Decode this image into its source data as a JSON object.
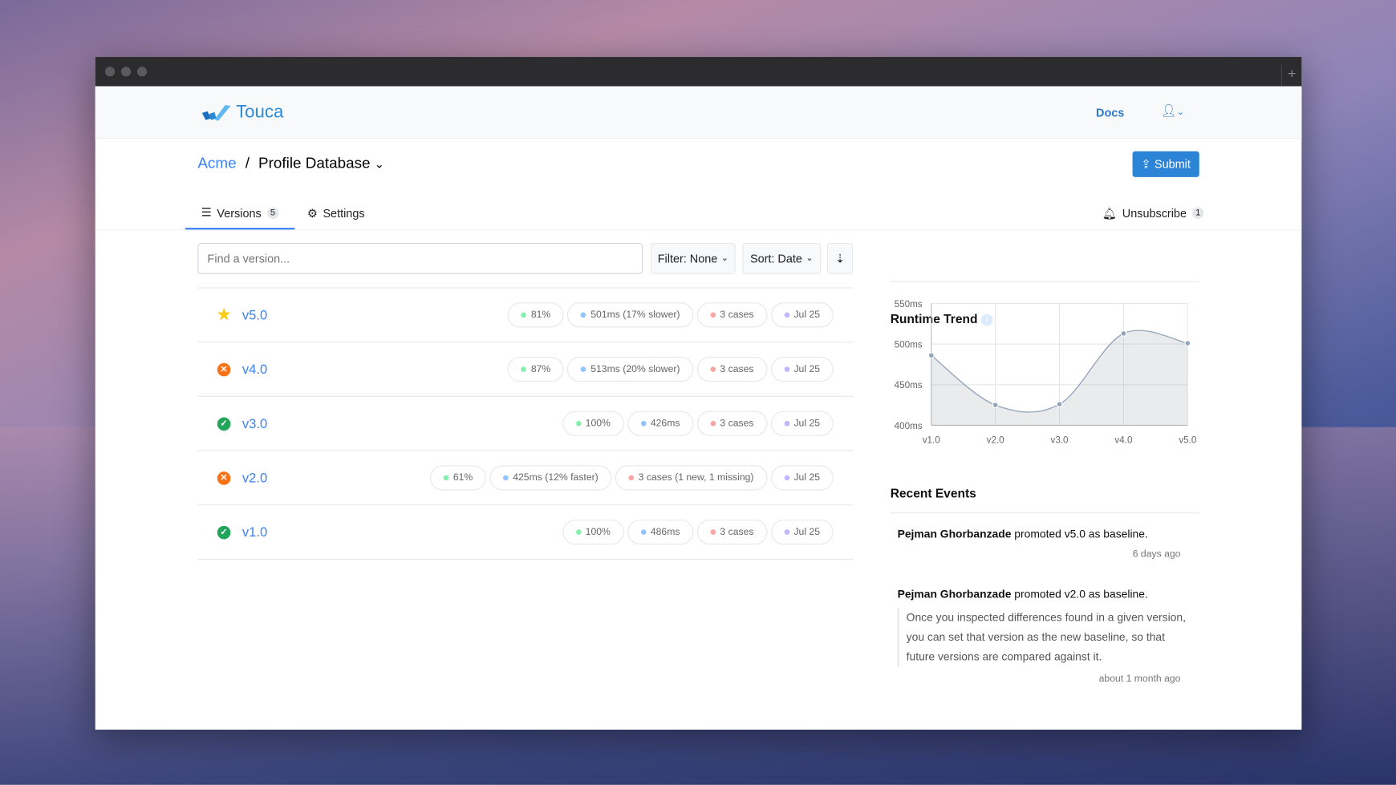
{
  "app": {
    "name": "Touca",
    "docs": "Docs"
  },
  "breadcrumb": {
    "team": "Acme",
    "suite": "Profile Database"
  },
  "submit_label": "Submit",
  "tabs": [
    {
      "label": "Versions",
      "count": "5"
    },
    {
      "label": "Settings"
    }
  ],
  "unsubscribe": {
    "label": "Unsubscribe",
    "count": "1"
  },
  "search": {
    "placeholder": "Find a version..."
  },
  "filter_label": "Filter: None",
  "sort_label": "Sort: Date",
  "versions": [
    {
      "name": "v5.0",
      "status": "baseline",
      "score": "81%",
      "runtime": "501ms (17% slower)",
      "cases": "3 cases",
      "date": "Jul 25"
    },
    {
      "name": "v4.0",
      "status": "failed",
      "score": "87%",
      "runtime": "513ms (20% slower)",
      "cases": "3 cases",
      "date": "Jul 25"
    },
    {
      "name": "v3.0",
      "status": "passed",
      "score": "100%",
      "runtime": "426ms",
      "cases": "3 cases",
      "date": "Jul 25"
    },
    {
      "name": "v2.0",
      "status": "failed",
      "score": "61%",
      "runtime": "425ms (12% faster)",
      "cases": "3 cases (1 new, 1 missing)",
      "date": "Jul 25"
    },
    {
      "name": "v1.0",
      "status": "passed",
      "score": "100%",
      "runtime": "486ms",
      "cases": "3 cases",
      "date": "Jul 25"
    }
  ],
  "colors": {
    "accent": "#2b84d6",
    "star": "#facc15",
    "failed": "#f97316",
    "passed": "#22a55a",
    "score_dot": "#86efac",
    "runtime_dot": "#93c5fd",
    "cases_dot": "#fca5a5",
    "date_dot": "#c4b5fd"
  },
  "chart_data": {
    "type": "area",
    "title": "Runtime Trend",
    "categories": [
      "v1.0",
      "v2.0",
      "v3.0",
      "v4.0",
      "v5.0"
    ],
    "values": [
      486,
      425,
      426,
      513,
      501
    ],
    "ylim": [
      400,
      550
    ],
    "yticks": [
      "400ms",
      "450ms",
      "500ms",
      "550ms"
    ],
    "grid": true
  },
  "events": {
    "title": "Recent Events",
    "items": [
      {
        "user": "Pejman Ghorbanzade",
        "text": "promoted v5.0 as baseline.",
        "ago": "6 days ago"
      },
      {
        "user": "Pejman Ghorbanzade",
        "text": "promoted v2.0 as baseline.",
        "reason": "Once you inspected differences found in a given version, you can set that version as the new baseline, so that future versions are compared against it.",
        "ago": "about 1 month ago"
      }
    ]
  }
}
